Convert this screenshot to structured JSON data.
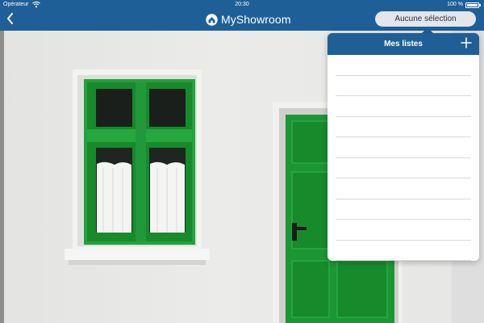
{
  "status_bar": {
    "carrier": "Opérateur",
    "time": "20:30",
    "battery_percent_label": "100 %",
    "battery_level": 1.0,
    "icons": [
      "wifi-icon",
      "battery-icon"
    ]
  },
  "nav": {
    "back_icon": "chevron-left-icon",
    "logo_icon": "home-icon",
    "title": "MyShowroom",
    "selection_button_label": "Aucune sélection"
  },
  "popover": {
    "title": "Mes listes",
    "add_icon": "plus-icon",
    "rows": [
      "",
      "",
      "",
      "",
      "",
      "",
      "",
      "",
      "",
      ""
    ]
  },
  "colors": {
    "bar": "#1f5f97",
    "accent_green": "#1f9a34",
    "wall": "#e8e8e6"
  }
}
